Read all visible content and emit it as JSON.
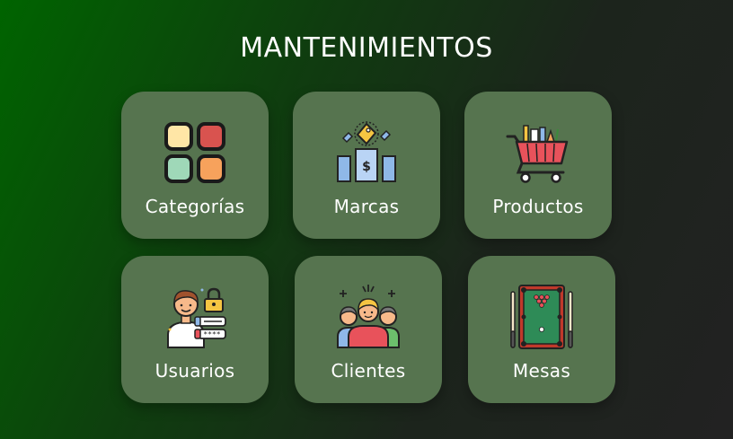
{
  "page": {
    "title": "MANTENIMIENTOS"
  },
  "cards": [
    {
      "label": "Categorías",
      "icon": "categories-grid-icon"
    },
    {
      "label": "Marcas",
      "icon": "brand-tags-icon"
    },
    {
      "label": "Productos",
      "icon": "shopping-cart-icon"
    },
    {
      "label": "Usuarios",
      "icon": "user-password-icon"
    },
    {
      "label": "Clientes",
      "icon": "customers-group-icon"
    },
    {
      "label": "Mesas",
      "icon": "billiard-table-icon"
    }
  ],
  "colors": {
    "background_start": "#006400",
    "background_end": "#222222",
    "card_background": "#56744f",
    "text": "#ffffff"
  }
}
